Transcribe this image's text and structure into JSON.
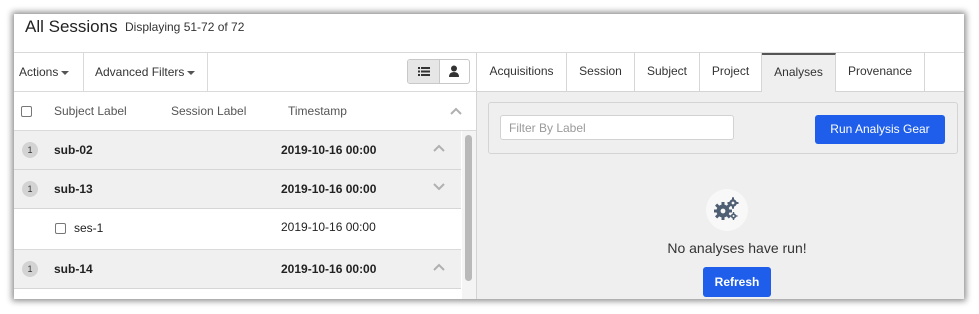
{
  "header": {
    "title": "All Sessions",
    "subtitle": "Displaying 51-72 of 72"
  },
  "toolbar": {
    "actions_label": "Actions",
    "filters_label": "Advanced Filters",
    "list_view_icon": "list-icon",
    "user_view_icon": "user-icon"
  },
  "columns": {
    "subject": "Subject Label",
    "session": "Session Label",
    "timestamp": "Timestamp"
  },
  "rows": [
    {
      "badge": "1",
      "label": "sub-02",
      "timestamp": "2019-10-16 00:00",
      "expanded": false
    },
    {
      "badge": "1",
      "label": "sub-13",
      "timestamp": "2019-10-16 00:00",
      "expanded": true
    },
    {
      "label": "ses-1",
      "timestamp": "2019-10-16 00:00"
    },
    {
      "badge": "1",
      "label": "sub-14",
      "timestamp": "2019-10-16 00:00",
      "expanded": false
    }
  ],
  "tabs": [
    {
      "label": "Acquisitions"
    },
    {
      "label": "Session"
    },
    {
      "label": "Subject"
    },
    {
      "label": "Project"
    },
    {
      "label": "Analyses",
      "active": true
    },
    {
      "label": "Provenance"
    }
  ],
  "analyses": {
    "filter_placeholder": "Filter By Label",
    "run_button": "Run Analysis Gear",
    "empty_icon": "gears-icon",
    "empty_message": "No analyses have run!",
    "refresh_button": "Refresh"
  },
  "colors": {
    "primary": "#1e5eea",
    "row_bg": "#f0f0f0",
    "panel_bg": "#efefef"
  }
}
